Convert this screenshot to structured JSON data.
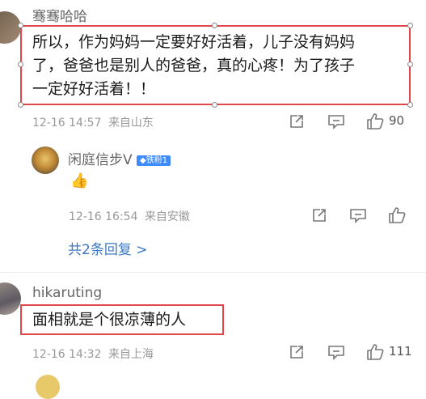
{
  "comments": [
    {
      "username": "骞骞哈哈",
      "text_lines": [
        "所以，作为妈妈一定要好好活着，儿子没有妈妈",
        "了，爸爸也是别人的爸爸，真的心疼！为了孩子",
        "一定好好活着！！"
      ],
      "time": "12-16 14:57",
      "location": "来自山东",
      "likes": "90"
    },
    {
      "username": "闲庭信步V",
      "badge": "◆铁粉1",
      "emoji": "👍",
      "time": "12-16 16:54",
      "location": "来自安徽",
      "replies_link": "共2条回复 >"
    },
    {
      "username": "hikaruting",
      "text": "面相就是个很凉薄的人",
      "time": "12-16 14:32",
      "location": "来自上海",
      "likes": "111"
    }
  ],
  "colors": {
    "highlight": "#e0464a",
    "link": "#3b78c4",
    "badge": "#3d8bff"
  }
}
